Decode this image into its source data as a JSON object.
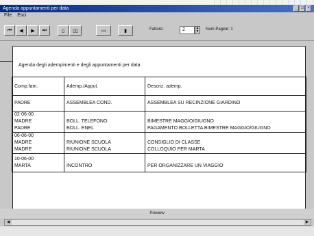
{
  "window": {
    "title": "Agenda appuntamenti per data",
    "controls": [
      "_",
      "□",
      "×"
    ]
  },
  "menu": [
    "File",
    "Esci"
  ],
  "toolbar": {
    "nav_icons": [
      "first-page-icon",
      "prev-page-icon",
      "next-page-icon",
      "last-page-icon"
    ],
    "page_view_icons": [
      "single-page-icon",
      "two-page-icon"
    ],
    "print_setup_icon": "print-setup-icon",
    "close_icon": "close-preview-icon",
    "zoom_label": "Fattore:",
    "zoom_value": "2",
    "page_count_label": "Num.Pagine: 1"
  },
  "report": {
    "title": "Agenda degli adempimenti e degli appuntamenti per data",
    "columns": [
      "Comp.fam.",
      "Ademp./Apput.",
      "Descriz. ademp."
    ],
    "rows": [
      {
        "date": "",
        "c1": [
          "PADRE"
        ],
        "c2": [
          "ASSEMBLEA COND."
        ],
        "c3": [
          "ASSEMBLEA SU RECINZIONE GIARDINO"
        ]
      },
      {
        "date": "02-06-00",
        "c1": [
          "MADRE",
          "PADRE"
        ],
        "c2": [
          "BOLL. TELEFONO",
          "BOLL. ENEL"
        ],
        "c3": [
          "BIMESTRE MAGGIO/GIUGNO",
          "PAGAMENTO BOLLETTA BIMESTRE MAGGIO/GIUGNO"
        ]
      },
      {
        "date": "06-06-00",
        "c1": [
          "MADRE",
          "MADRE"
        ],
        "c2": [
          "RIUNIONE SCUOLA",
          "RIUNIONE SCUOLA"
        ],
        "c3": [
          "CONSIGLIO DI CLASSE",
          "COLLOQUIO PER MARTA"
        ]
      },
      {
        "date": "10-06-00",
        "c1": [
          "MARTA"
        ],
        "c2": [
          "INCONTRO"
        ],
        "c3": [
          "PER ORGANIZZARE UN VIAGGIO"
        ]
      }
    ]
  },
  "preview_label": "Preview",
  "statusbar": {
    "left": "",
    "right": ""
  }
}
